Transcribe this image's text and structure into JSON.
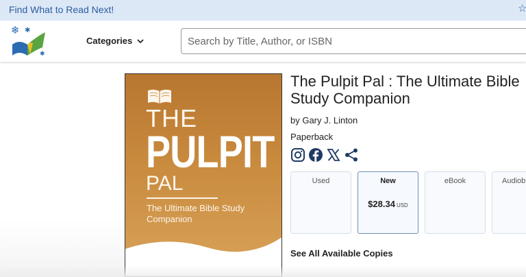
{
  "topbar": {
    "promo": "Find What to Read Next!",
    "star_icon": "star-icon"
  },
  "header": {
    "logo_icon": "abebooks-logo",
    "categories_label": "Categories",
    "search_placeholder": "Search by Title, Author, or ISBN"
  },
  "cover": {
    "the": "THE",
    "pulpit": "PULPIT",
    "pal": "PAL",
    "subtitle": "The Ultimate Bible Study Companion",
    "colors": {
      "top": "#b87630",
      "bottom": "#d9a35a",
      "wave": "#ffffff"
    }
  },
  "book": {
    "title": "The Pulpit Pal : The Ultimate Bible Study Companion",
    "author": "by Gary J. Linton",
    "format": "Paperback"
  },
  "social": [
    "instagram-icon",
    "facebook-icon",
    "x-icon",
    "share-icon"
  ],
  "options": [
    {
      "label": "Used",
      "price": "",
      "currency": ""
    },
    {
      "label": "New",
      "price": "$28.34",
      "currency": "USD",
      "selected": true
    },
    {
      "label": "eBook",
      "price": "",
      "currency": ""
    },
    {
      "label": "Audiob",
      "price": "",
      "currency": ""
    }
  ],
  "see_all": "See All Available Copies",
  "colors": {
    "accent": "#2b5d9e",
    "topbar_bg": "#dde8f7",
    "selected_border": "#6f8fb6"
  }
}
